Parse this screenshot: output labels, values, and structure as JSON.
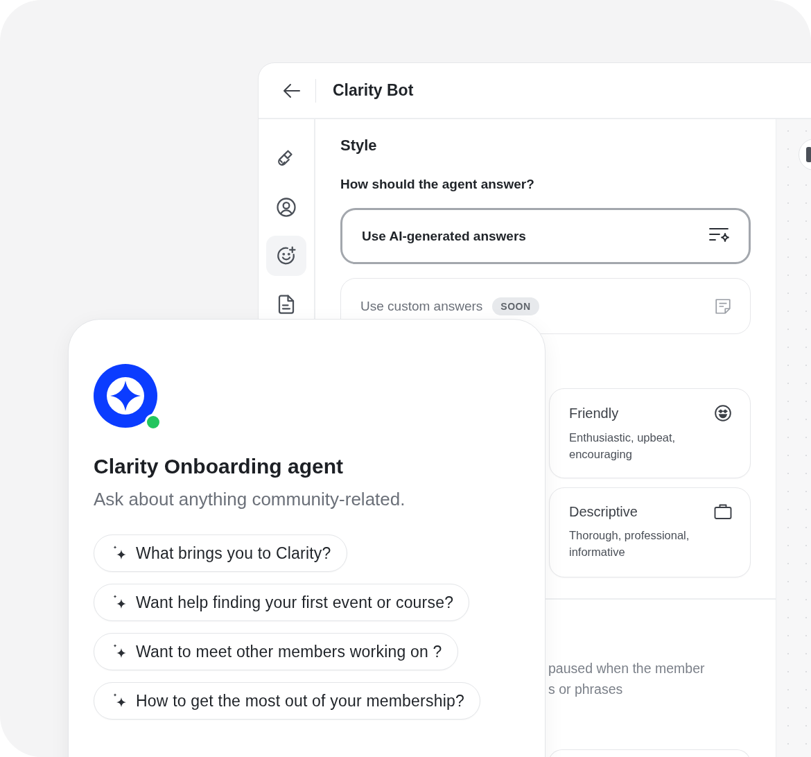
{
  "settings_window": {
    "title": "Clarity Bot",
    "sidebar": {
      "items": [
        {
          "kind": "brush",
          "selected": false
        },
        {
          "kind": "profile",
          "selected": false
        },
        {
          "kind": "face",
          "selected": true
        },
        {
          "kind": "document",
          "selected": false
        }
      ]
    },
    "section_title": "Style",
    "question": "How should the agent answer?",
    "answer_options": [
      {
        "label": "Use AI-generated answers",
        "selected": true,
        "disabled": false,
        "kind": "ai"
      },
      {
        "label": "Use custom answers",
        "badge": "SOON",
        "selected": false,
        "disabled": true,
        "kind": "note"
      }
    ],
    "tones": [
      {
        "title": "Friendly",
        "description": "Enthusiastic, upbeat, encouraging",
        "kind": "smile"
      },
      {
        "title": "Descriptive",
        "description": "Thorough, professional, informative",
        "kind": "briefcase"
      }
    ],
    "partial_text": [
      "paused when the member",
      "s or phrases"
    ]
  },
  "chat_card": {
    "title": "Clarity Onboarding agent",
    "subtitle": "Ask about anything community-related.",
    "online": true,
    "suggestions": [
      "What brings you to Clarity?",
      "Want help finding your first event or course?",
      "Want to meet other members working on ?",
      "How to get the most out of your membership?"
    ]
  }
}
